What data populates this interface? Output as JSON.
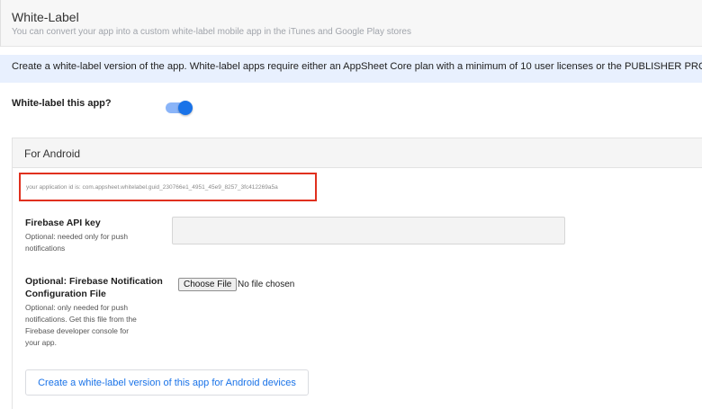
{
  "section": {
    "title": "White-Label",
    "subtitle": "You can convert your app into a custom white-label mobile app in the iTunes and Google Play stores"
  },
  "banner": {
    "text": "Create a white-label version of the app. White-label apps require either an AppSheet Core plan with a minimum of 10 user licenses or the PUBLISHER PRO plan."
  },
  "toggle": {
    "label": "White-label this app?",
    "on": true
  },
  "android": {
    "title": "For Android",
    "app_id_text": "your application id is: com.appsheet.whitelabel.guid_230766e1_4951_45e9_8257_3fc412269a5a",
    "firebase_key": {
      "label": "Firebase API key",
      "help_line1": "Optional: needed only for push",
      "help_line2": "notifications",
      "value": ""
    },
    "notification_file": {
      "label_line1": "Optional: Firebase Notification",
      "label_line2": "Configuration File",
      "help_line1": "Optional: only needed for push",
      "help_line2": "notifications. Get this file from the",
      "help_line3": "Firebase developer console for",
      "help_line4": "your app.",
      "button_label": "Choose File",
      "status": "No file chosen"
    },
    "create_button_label": "Create a white-label version of this app for Android devices"
  },
  "colors": {
    "accent": "#1a73e8",
    "toggle_track": "#8ab4f8",
    "banner_bg": "#e8f0fe",
    "highlight_border": "#e0301e"
  }
}
